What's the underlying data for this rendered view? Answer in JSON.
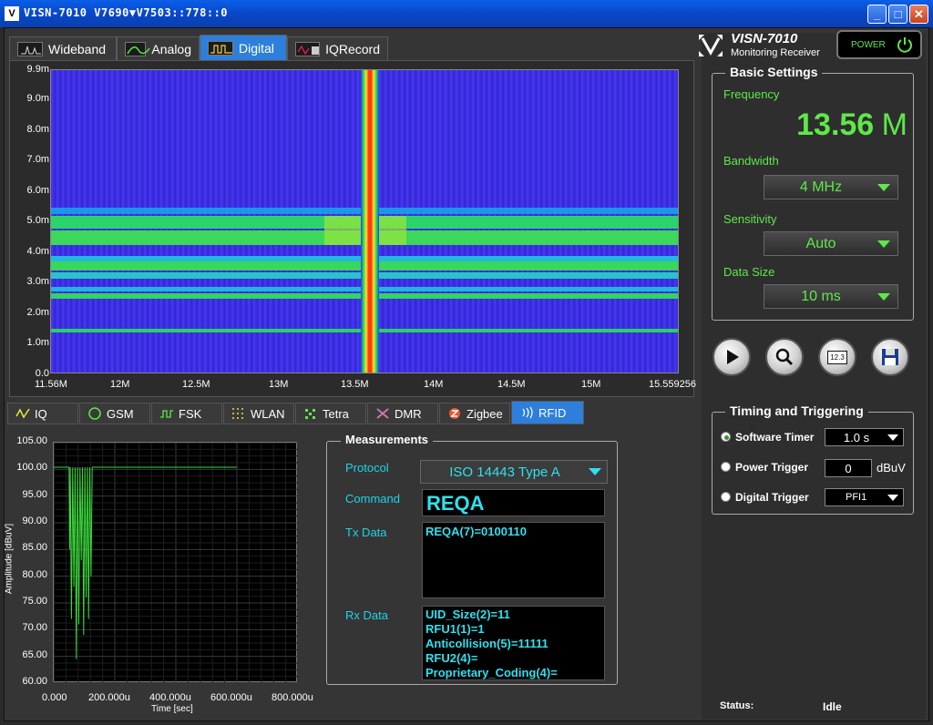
{
  "window": {
    "title": "VISN-7010 V7690▼V7503::778::0"
  },
  "top_tabs": [
    {
      "label": "Wideband"
    },
    {
      "label": "Analog"
    },
    {
      "label": "Digital"
    },
    {
      "label": "IQRecord"
    }
  ],
  "brand": {
    "name": "VISN-7010",
    "subtitle": "Monitoring Receiver",
    "power_label": "POWER"
  },
  "waterfall": {
    "y_ticks": [
      "9.9m",
      "9.0m",
      "8.0m",
      "7.0m",
      "6.0m",
      "5.0m",
      "4.0m",
      "3.0m",
      "2.0m",
      "1.0m",
      "0.0"
    ],
    "x_ticks": [
      "11.56M",
      "12M",
      "12.5M",
      "13M",
      "13.5M",
      "14M",
      "14.5M",
      "15M",
      "15.559256"
    ]
  },
  "bottom_tabs": [
    {
      "label": "IQ"
    },
    {
      "label": "GSM"
    },
    {
      "label": "FSK"
    },
    {
      "label": "WLAN"
    },
    {
      "label": "Tetra"
    },
    {
      "label": "DMR"
    },
    {
      "label": "Zigbee"
    },
    {
      "label": "RFID"
    }
  ],
  "chart_data": {
    "type": "line",
    "title": "",
    "xlabel": "Time [sec]",
    "ylabel": "Amplitude [dBuV]",
    "ylim": [
      60,
      105
    ],
    "xlim": [
      0,
      800
    ],
    "y_tick_labels": [
      "105.00",
      "100.00",
      "95.00",
      "90.00",
      "85.00",
      "80.00",
      "75.00",
      "70.00",
      "65.00",
      "60.00"
    ],
    "x_tick_labels": [
      "0.000",
      "200.000u",
      "400.000u",
      "600.000u",
      "800.000u"
    ],
    "series": [
      {
        "x": [
          0,
          50,
          52,
          54,
          58,
          62,
          66,
          70,
          74,
          78,
          82,
          86,
          90,
          94,
          98,
          102,
          106,
          110,
          114,
          118,
          122,
          126,
          130,
          600
        ],
        "values": [
          100.4,
          100.4,
          85,
          100.4,
          72,
          100.4,
          78,
          100.4,
          64.5,
          100.4,
          71,
          100.4,
          83,
          100.4,
          69,
          100.4,
          76,
          100.4,
          72,
          100.4,
          80,
          100.4,
          100.4,
          100.4
        ]
      }
    ]
  },
  "measurements": {
    "title": "Measurements",
    "protocol_label": "Protocol",
    "protocol_value": "ISO 14443 Type A",
    "command_label": "Command",
    "command_value": "REQA",
    "tx_label": "Tx Data",
    "tx_value": "REQA(7)=0100110",
    "rx_label": "Rx Data",
    "rx_lines": [
      "UID_Size(2)=11",
      "RFU1(1)=1",
      "Anticollision(5)=11111",
      "RFU2(4)=",
      "Proprietary_Coding(4)="
    ]
  },
  "basic_settings": {
    "title": "Basic Settings",
    "frequency_label": "Frequency",
    "frequency_value": "13.56",
    "frequency_unit": "M",
    "bandwidth_label": "Bandwidth",
    "bandwidth_value": "4  MHz",
    "sensitivity_label": "Sensitivity",
    "sensitivity_value": "Auto",
    "datasize_label": "Data Size",
    "datasize_value": "10  ms"
  },
  "action_buttons": {
    "counter_label": "12.3"
  },
  "timing": {
    "title": "Timing and Triggering",
    "software_timer_label": "Software Timer",
    "software_timer_value": "1.0 s",
    "power_trigger_label": "Power Trigger",
    "power_trigger_value": "0",
    "power_trigger_unit": "dBuV",
    "digital_trigger_label": "Digital Trigger",
    "digital_trigger_value": "PFI1"
  },
  "status": {
    "label": "Status:",
    "value": "Idle"
  },
  "colors": {
    "accent_blue": "#2d7fdb",
    "green_text": "#5ee84a",
    "cyan_text": "#2fe0ee",
    "trace_green": "#3cd93c"
  }
}
